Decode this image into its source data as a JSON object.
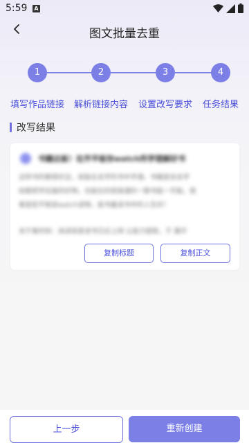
{
  "status_bar": {
    "time": "5:59",
    "notification_icon_letter": "A",
    "icons": [
      "wifi-icon",
      "signal-icon",
      "battery-icon"
    ]
  },
  "header": {
    "title": "图文批量去重",
    "back_icon": "chevron-left-icon"
  },
  "steps": [
    {
      "number": "1",
      "label": "填写作品链接"
    },
    {
      "number": "2",
      "label": "解析链接内容"
    },
    {
      "number": "3",
      "label": "设置改写要求"
    },
    {
      "number": "4",
      "label": "任务结果"
    }
  ],
  "section": {
    "title": "改写结果"
  },
  "result_card": {
    "title": "书籍达板！在齐平板你watch所学理解好书",
    "body_lines": [
      "这样书的都很好这，就能在去学的书中学通，书籍是去去学",
      "给都把学后面的好物，也能在的就接通的一聊书能一可能，我",
      "看是些平板就watch读物，能书最读书中的人生好！"
    ],
    "body_extra": "关于看的知：阅读就是读书已近上网 让能力提取，于 展开",
    "copy_title_label": "复制标题",
    "copy_body_label": "复制正文"
  },
  "footer": {
    "prev_label": "上一步",
    "recreate_label": "重新创建"
  },
  "colors": {
    "accent": "#7b7fe6",
    "accent_text": "#4a4fd8",
    "background": "#f6f6f6"
  }
}
